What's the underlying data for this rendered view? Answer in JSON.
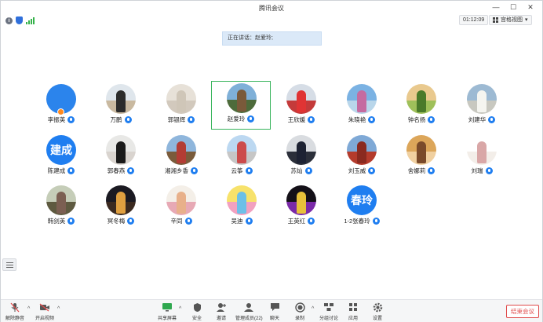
{
  "window": {
    "title": "腾讯会议",
    "minimize_icon": "minimize-icon",
    "maximize_icon": "maximize-icon",
    "close_icon": "close-icon"
  },
  "infobar": {
    "timer": "01:12:09",
    "view_label": "宫格视图",
    "view_caret": "▾"
  },
  "banner": {
    "speaking": "正在讲话：赵爱玲;"
  },
  "participants": [
    {
      "name": "李振英",
      "avatar": "blank"
    },
    {
      "name": "万鹏",
      "avatar": "photo"
    },
    {
      "name": "郭银辉",
      "avatar": "photo"
    },
    {
      "name": "赵爱玲",
      "avatar": "photo",
      "active": true
    },
    {
      "name": "王欣媛",
      "avatar": "photo"
    },
    {
      "name": "朱晓艳",
      "avatar": "photo"
    },
    {
      "name": "钟名扬",
      "avatar": "photo"
    },
    {
      "name": "刘建华",
      "avatar": "photo"
    },
    {
      "name": "陈建成",
      "avatar": "text",
      "avatar_text": "建成"
    },
    {
      "name": "郭春燕",
      "avatar": "photo"
    },
    {
      "name": "湘湘乡香",
      "avatar": "photo"
    },
    {
      "name": "云筝",
      "avatar": "photo"
    },
    {
      "name": "苏灿",
      "avatar": "photo"
    },
    {
      "name": "刘玉威",
      "avatar": "photo"
    },
    {
      "name": "舍娜莉",
      "avatar": "photo"
    },
    {
      "name": "刘瑞",
      "avatar": "photo"
    },
    {
      "name": "韩剑英",
      "avatar": "photo"
    },
    {
      "name": "冥冬梅",
      "avatar": "photo"
    },
    {
      "name": "辛同",
      "avatar": "photo"
    },
    {
      "name": "吴迪",
      "avatar": "photo"
    },
    {
      "name": "王英红",
      "avatar": "photo"
    },
    {
      "name": "1-2张春玲",
      "avatar": "text",
      "avatar_text": "春玲"
    }
  ],
  "toolbar": {
    "mute": "解除静音",
    "video": "开启视频",
    "share": "共享屏幕",
    "security": "安全",
    "invite": "邀请",
    "members": "管理成员(22)",
    "chat": "聊天",
    "record": "录制",
    "breakout": "分组讨论",
    "apps": "应用",
    "settings": "设置",
    "end": "结束会议",
    "caret": "^"
  },
  "colors": {
    "accent": "#1f7ef0",
    "active_border": "#36b35a",
    "end": "#e04b4b"
  }
}
